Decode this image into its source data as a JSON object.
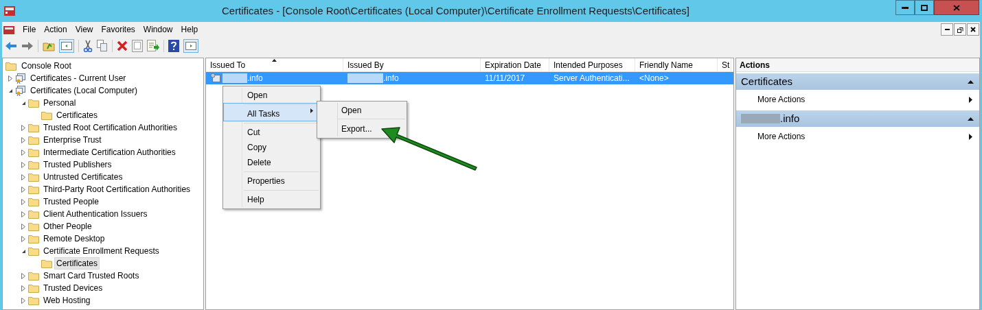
{
  "window": {
    "title": "Certificates - [Console Root\\Certificates (Local Computer)\\Certificate Enrollment Requests\\Certificates]"
  },
  "menu_bar": [
    "File",
    "Action",
    "View",
    "Favorites",
    "Window",
    "Help"
  ],
  "tree": [
    {
      "label": "Console Root",
      "kind": "folder",
      "selected": false,
      "children": [
        {
          "label": "Certificates - Current User",
          "kind": "store",
          "expanded": false,
          "selected": false
        },
        {
          "label": "Certificates (Local Computer)",
          "kind": "store",
          "expanded": true,
          "selected": false,
          "children": [
            {
              "label": "Personal",
              "kind": "folder",
              "expanded": true,
              "selected": false,
              "children": [
                {
                  "label": "Certificates",
                  "kind": "folder",
                  "selected": false
                }
              ]
            },
            {
              "label": "Trusted Root Certification Authorities",
              "kind": "folder",
              "expanded": false,
              "selected": false
            },
            {
              "label": "Enterprise Trust",
              "kind": "folder",
              "expanded": false,
              "selected": false
            },
            {
              "label": "Intermediate Certification Authorities",
              "kind": "folder",
              "expanded": false,
              "selected": false
            },
            {
              "label": "Trusted Publishers",
              "kind": "folder",
              "expanded": false,
              "selected": false
            },
            {
              "label": "Untrusted Certificates",
              "kind": "folder",
              "expanded": false,
              "selected": false
            },
            {
              "label": "Third-Party Root Certification Authorities",
              "kind": "folder",
              "expanded": false,
              "selected": false
            },
            {
              "label": "Trusted People",
              "kind": "folder",
              "expanded": false,
              "selected": false
            },
            {
              "label": "Client Authentication Issuers",
              "kind": "folder",
              "expanded": false,
              "selected": false
            },
            {
              "label": "Other People",
              "kind": "folder",
              "expanded": false,
              "selected": false
            },
            {
              "label": "Remote Desktop",
              "kind": "folder",
              "expanded": false,
              "selected": false
            },
            {
              "label": "Certificate Enrollment Requests",
              "kind": "folder",
              "expanded": true,
              "selected": false,
              "children": [
                {
                  "label": "Certificates",
                  "kind": "folder",
                  "selected": true
                }
              ]
            },
            {
              "label": "Smart Card Trusted Roots",
              "kind": "folder",
              "expanded": false,
              "selected": false
            },
            {
              "label": "Trusted Devices",
              "kind": "folder",
              "expanded": false,
              "selected": false
            },
            {
              "label": "Web Hosting",
              "kind": "folder",
              "expanded": false,
              "selected": false
            }
          ]
        }
      ]
    }
  ],
  "table": {
    "columns": [
      {
        "label": "Issued To",
        "sorted": true
      },
      {
        "label": "Issued By",
        "sorted": false
      },
      {
        "label": "Expiration Date",
        "sorted": false
      },
      {
        "label": "Intended Purposes",
        "sorted": false
      },
      {
        "label": "Friendly Name",
        "sorted": false
      },
      {
        "label": "St",
        "sorted": false
      }
    ],
    "rows": [
      {
        "selected": true,
        "cells": [
          {
            "text": ".info",
            "redacted": true
          },
          {
            "text": ".info",
            "redacted": true
          },
          {
            "text": "11/11/2017",
            "redacted": false
          },
          {
            "text": "Server Authenticati...",
            "redacted": false
          },
          {
            "text": "<None>",
            "redacted": false
          }
        ]
      }
    ]
  },
  "context_menu": {
    "items": [
      {
        "label": "Open",
        "highlighted": false,
        "has_submenu": false,
        "divider_before": false
      },
      {
        "label": "All Tasks",
        "highlighted": true,
        "has_submenu": true,
        "divider_before": true
      },
      {
        "label": "Cut",
        "highlighted": false,
        "has_submenu": false,
        "divider_before": true
      },
      {
        "label": "Copy",
        "highlighted": false,
        "has_submenu": false,
        "divider_before": false
      },
      {
        "label": "Delete",
        "highlighted": false,
        "has_submenu": false,
        "divider_before": false
      },
      {
        "label": "Properties",
        "highlighted": false,
        "has_submenu": false,
        "divider_before": true
      },
      {
        "label": "Help",
        "highlighted": false,
        "has_submenu": false,
        "divider_before": true
      }
    ],
    "submenu": [
      {
        "label": "Open",
        "divider_before": false
      },
      {
        "label": "Export...",
        "divider_before": true
      }
    ]
  },
  "actions": {
    "title": "Actions",
    "sections": [
      {
        "title": "Certificates",
        "redacted": false,
        "expanded": true,
        "items": [
          "More Actions"
        ]
      },
      {
        "title": ".info",
        "redacted": true,
        "expanded": true,
        "items": [
          "More Actions"
        ]
      }
    ]
  }
}
